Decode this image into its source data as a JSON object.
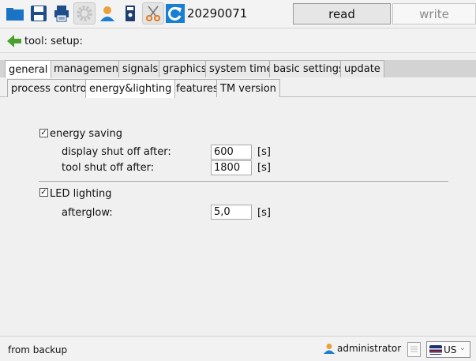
{
  "toolbar": {
    "version": "20290071",
    "read_label": "read",
    "write_label": "write"
  },
  "path": {
    "text": "tool: setup:"
  },
  "tabs_main": [
    {
      "label": "general",
      "active": true
    },
    {
      "label": "management",
      "active": false
    },
    {
      "label": "signals",
      "active": false
    },
    {
      "label": "graphics",
      "active": false
    },
    {
      "label": "system time",
      "active": false
    },
    {
      "label": "basic settings",
      "active": false
    },
    {
      "label": "update",
      "active": false
    }
  ],
  "tabs_sub": [
    {
      "label": "process control",
      "active": false
    },
    {
      "label": "energy&lighting",
      "active": true
    },
    {
      "label": "features",
      "active": false
    },
    {
      "label": "TM version",
      "active": false
    }
  ],
  "energy": {
    "label": "energy saving",
    "checked": true,
    "display_label": "display shut off after:",
    "display_value": "600",
    "display_unit": "[s]",
    "tool_label": "tool shut off after:",
    "tool_value": "1800",
    "tool_unit": "[s]"
  },
  "led": {
    "label": "LED lighting",
    "checked": true,
    "afterglow_label": "afterglow:",
    "afterglow_value": "5,0",
    "afterglow_unit": "[s]"
  },
  "status": {
    "text": "from backup",
    "user": "administrator",
    "language": "US"
  },
  "colors": {
    "accent": "#1a7fd0",
    "folder": "#1a73c4",
    "user_icon": "#e8a23a"
  }
}
